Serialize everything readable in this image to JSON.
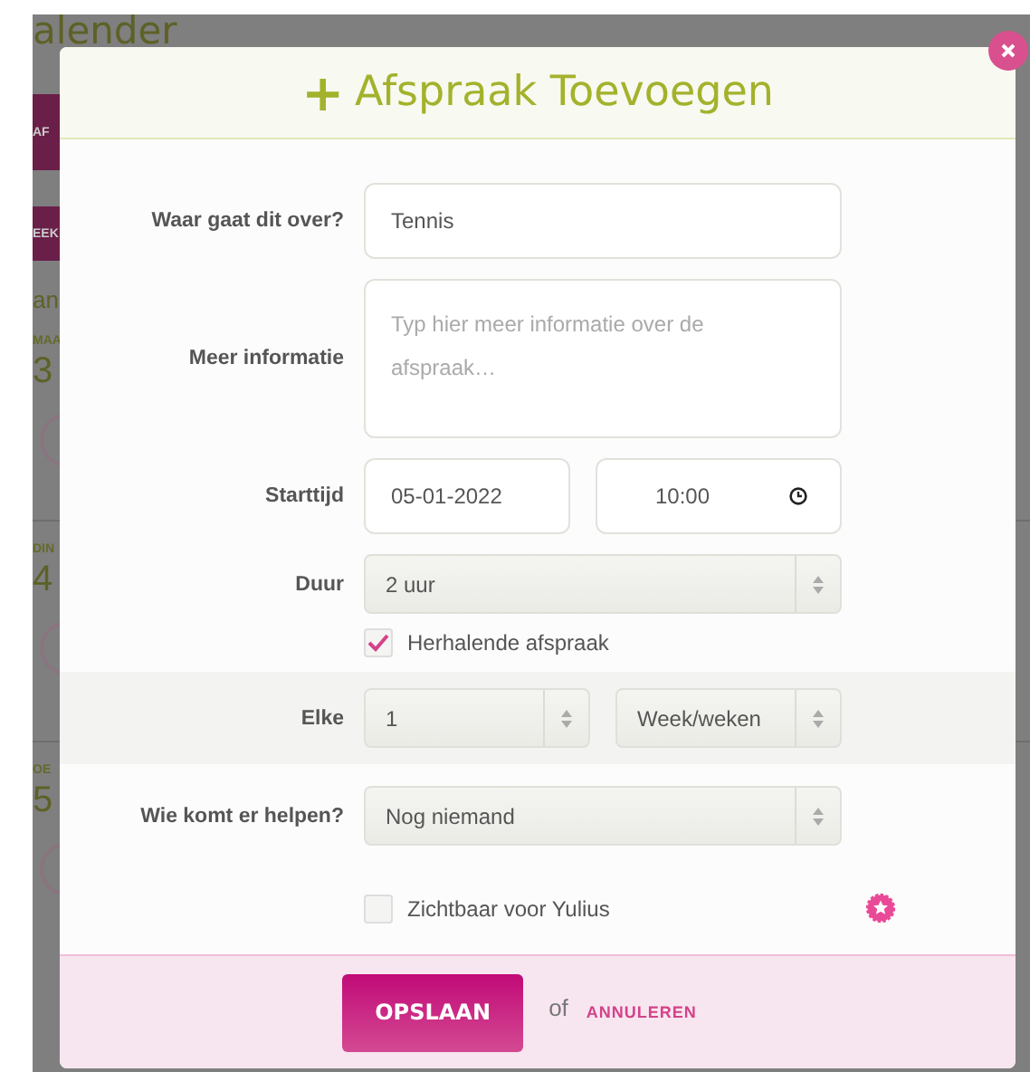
{
  "background": {
    "heading": "alender",
    "fragments": [
      {
        "kind": "button",
        "text": "AF"
      },
      {
        "kind": "button",
        "text": "EEK"
      },
      {
        "kind": "text",
        "text": "an"
      },
      {
        "kind": "day",
        "text": "MAA",
        "date": "3"
      },
      {
        "kind": "day",
        "text": "DIN",
        "date": "4"
      },
      {
        "kind": "day",
        "text": "OE",
        "date": "5"
      }
    ]
  },
  "dialog": {
    "icon": "+",
    "title": "Afspraak Toevoegen",
    "fields": [
      {
        "kind": "text",
        "label": "Waar gaat dit over?",
        "value": "Tennis"
      },
      {
        "kind": "textarea",
        "label": "Meer informatie",
        "placeholder": "Typ hier meer informatie over de afspraak…"
      },
      {
        "kind": "datetime",
        "label": "Starttijd",
        "date": "05-01-2022",
        "time": "10:00"
      },
      {
        "kind": "select",
        "label": "Duur",
        "value": "2 uur"
      },
      {
        "kind": "checkbox",
        "label": "Herhalende afspraak",
        "checked": true,
        "badge": false
      },
      {
        "kind": "repeat",
        "label": "Elke",
        "count": "1",
        "unit": "Week/weken"
      },
      {
        "kind": "select",
        "label": "Wie komt er helpen?",
        "value": "Nog niemand"
      },
      {
        "kind": "checkbox",
        "label": "Zichtbaar voor Yulius",
        "checked": false,
        "badge": true
      }
    ],
    "save": "OPSLAAN",
    "or": "of",
    "cancel": "ANNULEREN"
  }
}
